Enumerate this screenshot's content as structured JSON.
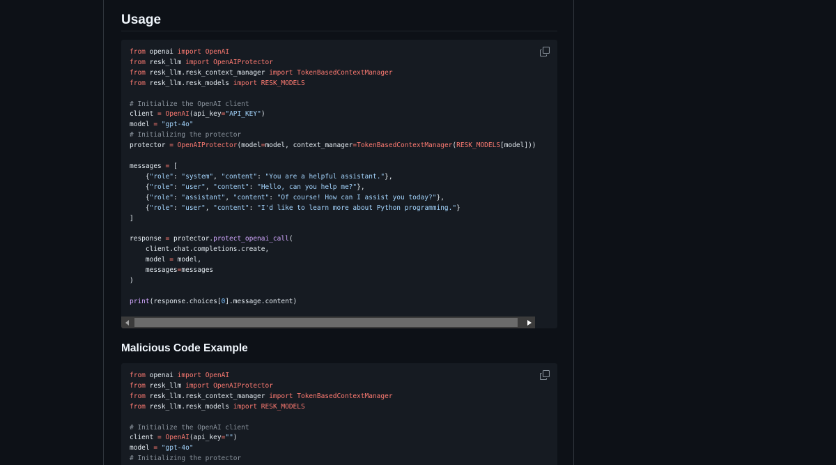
{
  "usage_section": {
    "heading": "Usage",
    "copy_icon": "copy-icon",
    "code_lines": [
      [
        [
          "from",
          "kw"
        ],
        [
          " openai ",
          ""
        ],
        [
          "import",
          "kw"
        ],
        [
          " ",
          ""
        ],
        [
          "OpenAI",
          "kw"
        ]
      ],
      [
        [
          "from",
          "kw"
        ],
        [
          " resk_llm ",
          ""
        ],
        [
          "import",
          "kw"
        ],
        [
          " ",
          ""
        ],
        [
          "OpenAIProtector",
          "kw"
        ]
      ],
      [
        [
          "from",
          "kw"
        ],
        [
          " resk_llm.resk_context_manager ",
          ""
        ],
        [
          "import",
          "kw"
        ],
        [
          " ",
          ""
        ],
        [
          "TokenBasedContextManager",
          "kw"
        ]
      ],
      [
        [
          "from",
          "kw"
        ],
        [
          " resk_llm.resk_models ",
          ""
        ],
        [
          "import",
          "kw"
        ],
        [
          " ",
          ""
        ],
        [
          "RESK_MODELS",
          "kw"
        ]
      ],
      [],
      [
        [
          "# Initialize the OpenAI client",
          "com"
        ]
      ],
      [
        [
          "client ",
          ""
        ],
        [
          "=",
          "kw"
        ],
        [
          " ",
          ""
        ],
        [
          "OpenAI",
          "kw"
        ],
        [
          "(api_key",
          ""
        ],
        [
          "=",
          "kw"
        ],
        [
          "\"API_KEY\"",
          "str"
        ],
        [
          ")",
          ""
        ]
      ],
      [
        [
          "model ",
          ""
        ],
        [
          "=",
          "kw"
        ],
        [
          " ",
          ""
        ],
        [
          "\"gpt-4o\"",
          "str"
        ]
      ],
      [
        [
          "# Initializing the protector",
          "com"
        ]
      ],
      [
        [
          "protector ",
          ""
        ],
        [
          "=",
          "kw"
        ],
        [
          " ",
          ""
        ],
        [
          "OpenAIProtector",
          "kw"
        ],
        [
          "(model",
          ""
        ],
        [
          "=",
          "kw"
        ],
        [
          "model, context_manager",
          ""
        ],
        [
          "=",
          "kw"
        ],
        [
          "TokenBasedContextManager",
          "kw"
        ],
        [
          "(",
          ""
        ],
        [
          "RESK_MODELS",
          "kw"
        ],
        [
          "[model]))",
          ""
        ]
      ],
      [],
      [
        [
          "messages ",
          ""
        ],
        [
          "=",
          "kw"
        ],
        [
          " [",
          ""
        ]
      ],
      [
        [
          "    {",
          ""
        ],
        [
          "\"role\"",
          "str"
        ],
        [
          ": ",
          ""
        ],
        [
          "\"system\"",
          "str"
        ],
        [
          ", ",
          ""
        ],
        [
          "\"content\"",
          "str"
        ],
        [
          ": ",
          ""
        ],
        [
          "\"You are a helpful assistant.\"",
          "str"
        ],
        [
          "},",
          ""
        ]
      ],
      [
        [
          "    {",
          ""
        ],
        [
          "\"role\"",
          "str"
        ],
        [
          ": ",
          ""
        ],
        [
          "\"user\"",
          "str"
        ],
        [
          ", ",
          ""
        ],
        [
          "\"content\"",
          "str"
        ],
        [
          ": ",
          ""
        ],
        [
          "\"Hello, can you help me?\"",
          "str"
        ],
        [
          "},",
          ""
        ]
      ],
      [
        [
          "    {",
          ""
        ],
        [
          "\"role\"",
          "str"
        ],
        [
          ": ",
          ""
        ],
        [
          "\"assistant\"",
          "str"
        ],
        [
          ", ",
          ""
        ],
        [
          "\"content\"",
          "str"
        ],
        [
          ": ",
          ""
        ],
        [
          "\"Of course! How can I assist you today?\"",
          "str"
        ],
        [
          "},",
          ""
        ]
      ],
      [
        [
          "    {",
          ""
        ],
        [
          "\"role\"",
          "str"
        ],
        [
          ": ",
          ""
        ],
        [
          "\"user\"",
          "str"
        ],
        [
          ", ",
          ""
        ],
        [
          "\"content\"",
          "str"
        ],
        [
          ": ",
          ""
        ],
        [
          "\"I'd like to learn more about Python programming.\"",
          "str"
        ],
        [
          "}",
          ""
        ]
      ],
      [
        [
          "]",
          ""
        ]
      ],
      [],
      [
        [
          "response ",
          ""
        ],
        [
          "=",
          "kw"
        ],
        [
          " protector.",
          ""
        ],
        [
          "protect_openai_call",
          "fn"
        ],
        [
          "(",
          ""
        ]
      ],
      [
        [
          "    client.chat.completions.create,",
          ""
        ]
      ],
      [
        [
          "    model ",
          ""
        ],
        [
          "=",
          "kw"
        ],
        [
          " model,",
          ""
        ]
      ],
      [
        [
          "    messages",
          ""
        ],
        [
          "=",
          "kw"
        ],
        [
          "messages",
          ""
        ]
      ],
      [
        [
          ")",
          ""
        ]
      ],
      [],
      [
        [
          "print",
          "fn"
        ],
        [
          "(response.choices[",
          ""
        ],
        [
          "0",
          "num"
        ],
        [
          "].message.content)",
          ""
        ]
      ]
    ]
  },
  "malicious_section": {
    "heading": "Malicious Code Example",
    "copy_icon": "copy-icon",
    "code_lines": [
      [
        [
          "from",
          "kw"
        ],
        [
          " openai ",
          ""
        ],
        [
          "import",
          "kw"
        ],
        [
          " ",
          ""
        ],
        [
          "OpenAI",
          "kw"
        ]
      ],
      [
        [
          "from",
          "kw"
        ],
        [
          " resk_llm ",
          ""
        ],
        [
          "import",
          "kw"
        ],
        [
          " ",
          ""
        ],
        [
          "OpenAIProtector",
          "kw"
        ]
      ],
      [
        [
          "from",
          "kw"
        ],
        [
          " resk_llm.resk_context_manager ",
          ""
        ],
        [
          "import",
          "kw"
        ],
        [
          " ",
          ""
        ],
        [
          "TokenBasedContextManager",
          "kw"
        ]
      ],
      [
        [
          "from",
          "kw"
        ],
        [
          " resk_llm.resk_models ",
          ""
        ],
        [
          "import",
          "kw"
        ],
        [
          " ",
          ""
        ],
        [
          "RESK_MODELS",
          "kw"
        ]
      ],
      [],
      [
        [
          "# Initialize the OpenAI client",
          "com"
        ]
      ],
      [
        [
          "client ",
          ""
        ],
        [
          "=",
          "kw"
        ],
        [
          " ",
          ""
        ],
        [
          "OpenAI",
          "kw"
        ],
        [
          "(api_key",
          ""
        ],
        [
          "=",
          "kw"
        ],
        [
          "\"\"",
          "str"
        ],
        [
          ")",
          ""
        ]
      ],
      [
        [
          "model ",
          ""
        ],
        [
          "=",
          "kw"
        ],
        [
          " ",
          ""
        ],
        [
          "\"gpt-4o\"",
          "str"
        ]
      ],
      [
        [
          "# Initializing the protector",
          "com"
        ]
      ]
    ]
  },
  "scrollbar": {
    "left_arrow_icon": "scroll-left-arrow-icon",
    "right_arrow_icon": "scroll-right-arrow-icon"
  },
  "colors": {
    "page_background": "#0d1117",
    "code_background": "#161b22",
    "keyword": "#ff7b72",
    "function": "#d2a8ff",
    "string": "#a5d6ff",
    "comment": "#8b949e",
    "heading": "#f0f6fc"
  }
}
